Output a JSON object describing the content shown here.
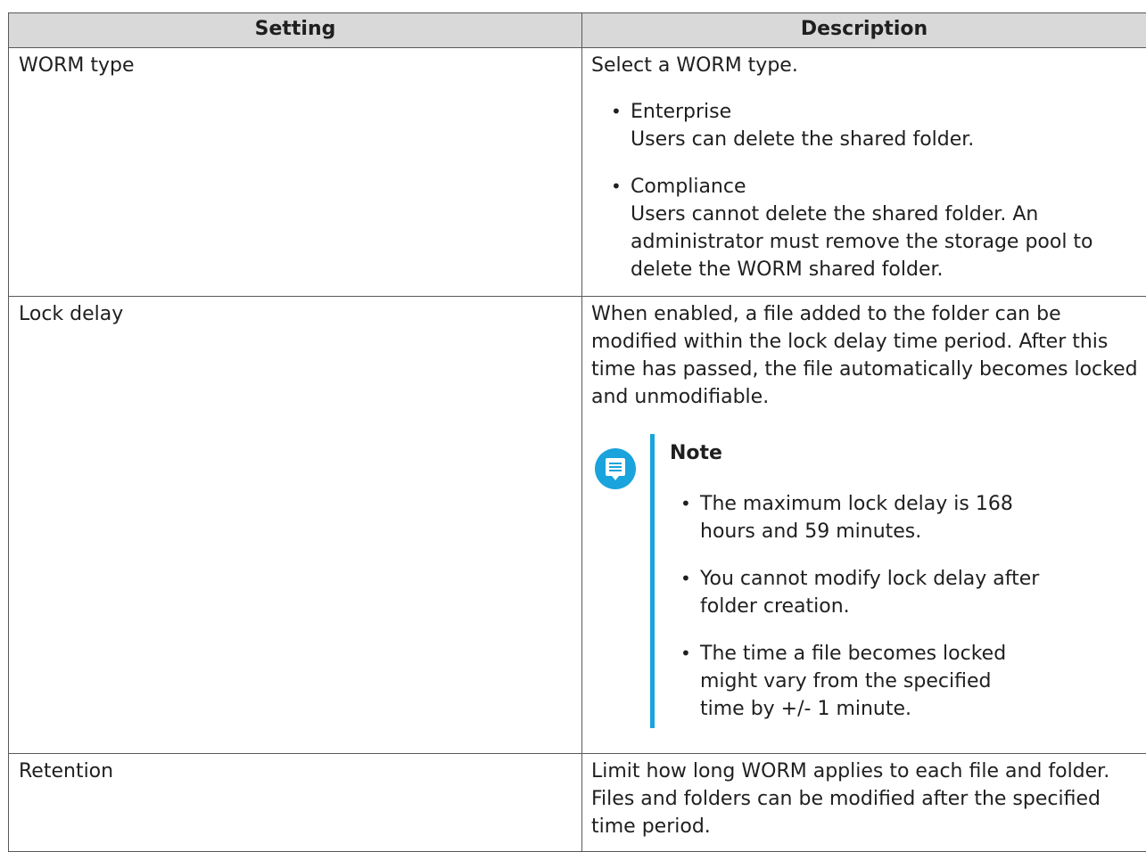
{
  "table": {
    "headers": {
      "setting": "Setting",
      "description": "Description"
    },
    "rows": [
      {
        "setting": "WORM type",
        "description": {
          "intro": "Select a WORM type.",
          "options": [
            {
              "title": "Enterprise",
              "text": "Users can delete the shared folder."
            },
            {
              "title": "Compliance",
              "text": "Users cannot delete the shared folder. An administrator must remove the storage pool to delete the WORM shared folder."
            }
          ]
        }
      },
      {
        "setting": "Lock delay",
        "description": {
          "intro": "When enabled, a file added to the folder can be modified within the lock delay time period. After this time has passed, the file automatically becomes locked and unmodifiable.",
          "note": {
            "title": "Note",
            "icon": "note-icon",
            "accent_color": "#1aa3dc",
            "items": [
              "The maximum lock delay is 168 hours and 59 minutes.",
              "You cannot modify lock delay after folder creation.",
              "The time a file becomes locked might vary from the specified time by +/- 1 minute."
            ]
          }
        }
      },
      {
        "setting": "Retention",
        "description": {
          "intro": "Limit how long WORM applies to each file and folder. Files and folders can be modified after the specified time period."
        }
      }
    ]
  }
}
